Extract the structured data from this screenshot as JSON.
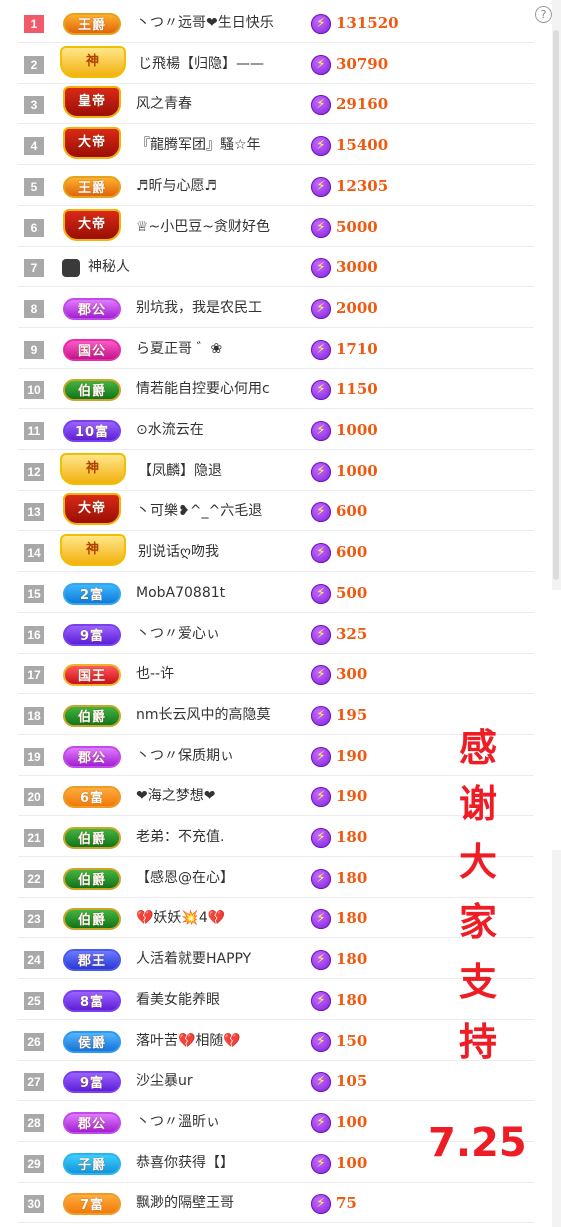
{
  "help_icon": "?",
  "bolt_icon": "⚡",
  "thanks_text": [
    "感",
    "谢",
    "大",
    "家",
    "支",
    "持"
  ],
  "date_text": "7.25",
  "accent_color": "#ee1c24",
  "amount_color": "#f05a10",
  "rows": [
    {
      "rank": "1",
      "badge": "王爵",
      "badge_type": "wang",
      "name": "丶つ〃远哥❤生日快乐",
      "amount": "131520"
    },
    {
      "rank": "2",
      "badge": "神",
      "badge_type": "shen",
      "name": "じ飛楊【归隐】——",
      "amount": "30790"
    },
    {
      "rank": "3",
      "badge": "皇帝",
      "badge_type": "emperor-tall",
      "name": "风之青春",
      "amount": "29160"
    },
    {
      "rank": "4",
      "badge": "大帝",
      "badge_type": "emperor-tall",
      "name": "『龍腾军团』騷☆年",
      "amount": "15400"
    },
    {
      "rank": "5",
      "badge": "王爵",
      "badge_type": "wang",
      "name": "♬昕与心愿♬",
      "amount": "12305"
    },
    {
      "rank": "6",
      "badge": "大帝",
      "badge_type": "emperor-tall",
      "name": "♕~小巴豆~贪财好色",
      "amount": "5000"
    },
    {
      "rank": "7",
      "badge": "",
      "badge_type": "mystery",
      "name": "神秘人",
      "amount": "3000"
    },
    {
      "rank": "8",
      "badge": "郡公",
      "badge_type": "duke",
      "name": "别坑我，我是农民工",
      "amount": "2000"
    },
    {
      "rank": "9",
      "badge": "国公",
      "badge_type": "guogong",
      "name": "ら夏正哥 ゛❀",
      "amount": "1710"
    },
    {
      "rank": "10",
      "badge": "伯爵",
      "badge_type": "earl",
      "name": "情若能自控要心何用c",
      "amount": "1150"
    },
    {
      "rank": "11",
      "badge": "10富",
      "badge_type": "rich-purple",
      "name": "⊙水流云在",
      "amount": "1000"
    },
    {
      "rank": "12",
      "badge": "神",
      "badge_type": "shen",
      "name": "【凤麟】隐退",
      "amount": "1000"
    },
    {
      "rank": "13",
      "badge": "大帝",
      "badge_type": "emperor-tall",
      "name": "丶可樂❥^_^六毛退",
      "amount": "600"
    },
    {
      "rank": "14",
      "badge": "神",
      "badge_type": "shen",
      "name": "别说话ღ吻我",
      "amount": "600"
    },
    {
      "rank": "15",
      "badge": "2富",
      "badge_type": "rich-blue",
      "name": "MobA70881t",
      "amount": "500"
    },
    {
      "rank": "16",
      "badge": "9富",
      "badge_type": "rich-purple",
      "name": "丶つ〃爱心ぃ",
      "amount": "325"
    },
    {
      "rank": "17",
      "badge": "国王",
      "badge_type": "king",
      "name": "也--许",
      "amount": "300"
    },
    {
      "rank": "18",
      "badge": "伯爵",
      "badge_type": "earl",
      "name": "nm长云风中的高隐莫",
      "amount": "195"
    },
    {
      "rank": "19",
      "badge": "郡公",
      "badge_type": "duke",
      "name": "丶つ〃保质期ぃ",
      "amount": "190"
    },
    {
      "rank": "20",
      "badge": "6富",
      "badge_type": "rich-orange",
      "name": "❤海之梦想❤",
      "amount": "190"
    },
    {
      "rank": "21",
      "badge": "伯爵",
      "badge_type": "earl",
      "name": "老弟：不充值.",
      "amount": "180"
    },
    {
      "rank": "22",
      "badge": "伯爵",
      "badge_type": "earl",
      "name": "【感恩@在心】",
      "amount": "180"
    },
    {
      "rank": "23",
      "badge": "伯爵",
      "badge_type": "earl",
      "name": "💔妖妖💥4💔",
      "amount": "180"
    },
    {
      "rank": "24",
      "badge": "郡王",
      "badge_type": "zhiking",
      "name": "人活着就要HAPPY",
      "amount": "180"
    },
    {
      "rank": "25",
      "badge": "8富",
      "badge_type": "rich-purple",
      "name": "看美女能养眼",
      "amount": "180"
    },
    {
      "rank": "26",
      "badge": "侯爵",
      "badge_type": "marquis",
      "name": "落叶苦💔相随💔",
      "amount": "150"
    },
    {
      "rank": "27",
      "badge": "9富",
      "badge_type": "rich-purple",
      "name": "沙尘暴ur",
      "amount": "105"
    },
    {
      "rank": "28",
      "badge": "郡公",
      "badge_type": "duke",
      "name": "丶つ〃溫昕ぃ",
      "amount": "100"
    },
    {
      "rank": "29",
      "badge": "子爵",
      "badge_type": "viscount",
      "name": "恭喜你获得【】",
      "amount": "100"
    },
    {
      "rank": "30",
      "badge": "7富",
      "badge_type": "rich-orange",
      "name": "飘渺的隔壁王哥",
      "amount": "75"
    }
  ]
}
